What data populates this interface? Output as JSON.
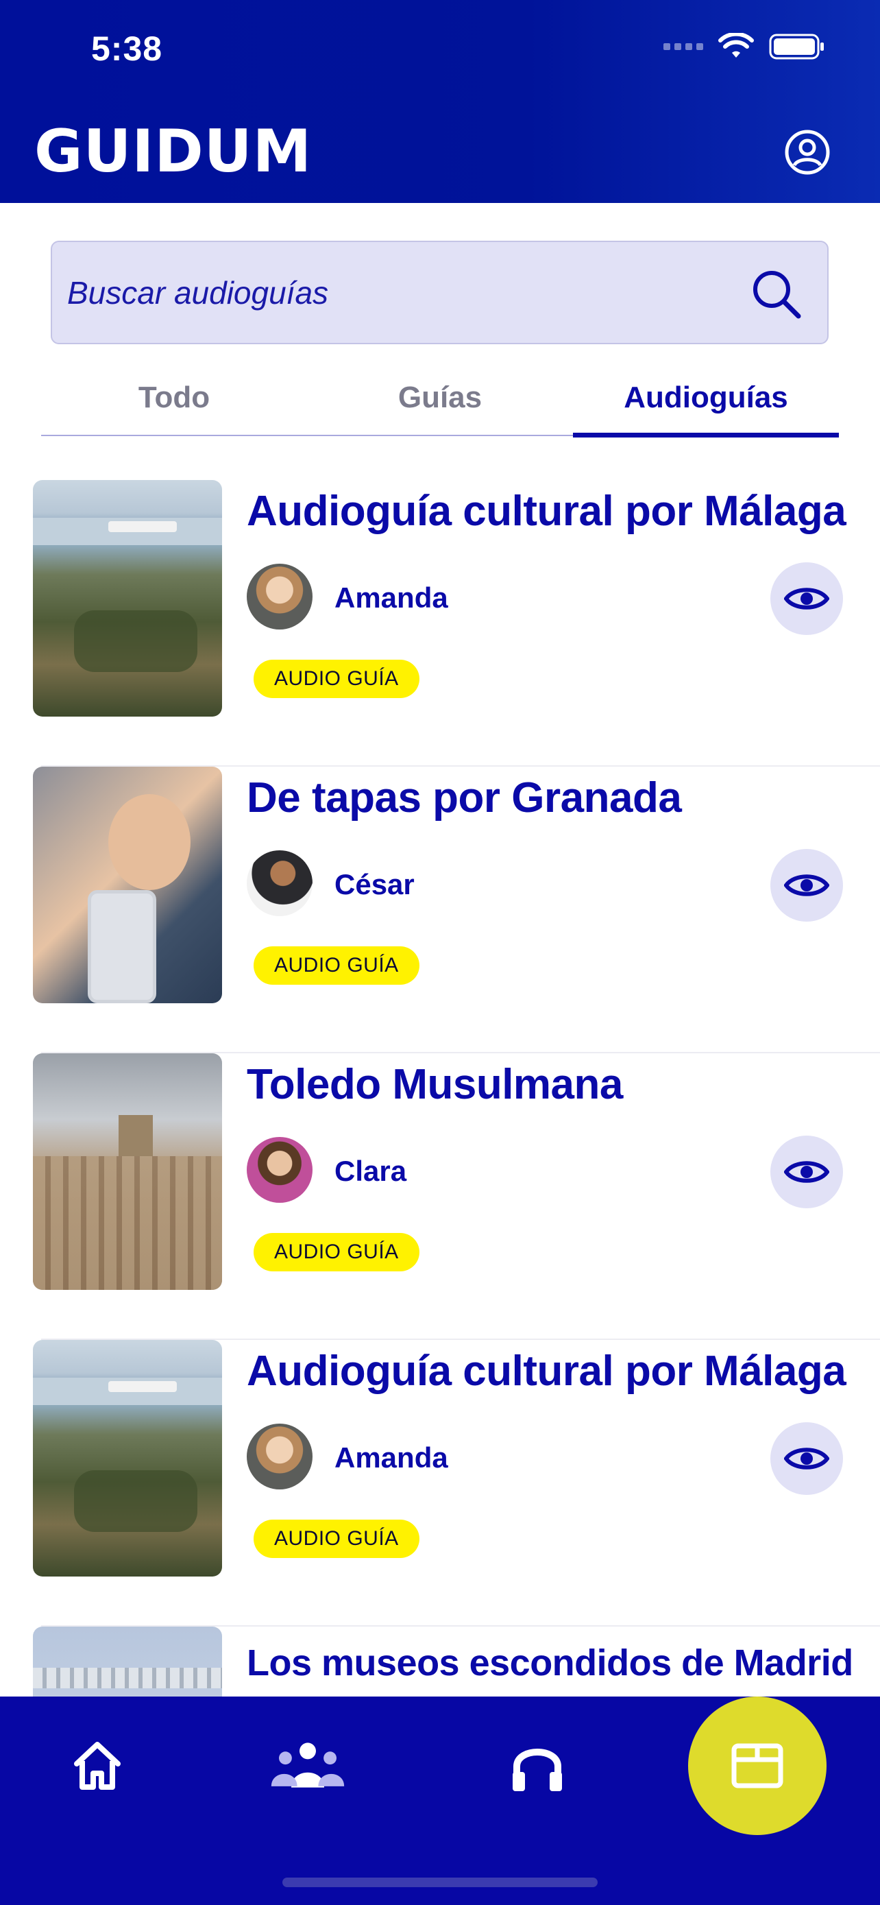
{
  "status_bar": {
    "time": "5:38"
  },
  "header": {
    "logo": "GUIDUM"
  },
  "search": {
    "placeholder": "Buscar audioguías"
  },
  "tabs": [
    {
      "label": "Todo",
      "active": false
    },
    {
      "label": "Guías",
      "active": false
    },
    {
      "label": "Audioguías",
      "active": true
    }
  ],
  "items": [
    {
      "title": "Audioguía cultural por Málaga",
      "author": "Amanda",
      "badge": "AUDIO GUÍA",
      "image": "malaga-port-photo"
    },
    {
      "title": "De tapas por Granada",
      "author": "César",
      "badge": "AUDIO GUÍA",
      "image": "woman-phone-photo"
    },
    {
      "title": "Toledo Musulmana",
      "author": "Clara",
      "badge": "AUDIO GUÍA",
      "image": "toledo-city-photo"
    },
    {
      "title": "Audioguía cultural por Málaga",
      "author": "Amanda",
      "badge": "AUDIO GUÍA",
      "image": "malaga-port-photo"
    },
    {
      "title": "Los museos escondidos de Madrid",
      "author": "",
      "badge": "",
      "image": "madrid-photo"
    }
  ],
  "bottom_nav": [
    {
      "icon": "home-icon",
      "active": false
    },
    {
      "icon": "community-icon",
      "active": false
    },
    {
      "icon": "headphones-icon",
      "active": false
    },
    {
      "icon": "folder-icon",
      "active": true
    }
  ],
  "colors": {
    "primary": "#0707a4",
    "accent_yellow": "#fff200",
    "active_nav": "#dedb2c",
    "search_bg": "#e1e1f6"
  }
}
